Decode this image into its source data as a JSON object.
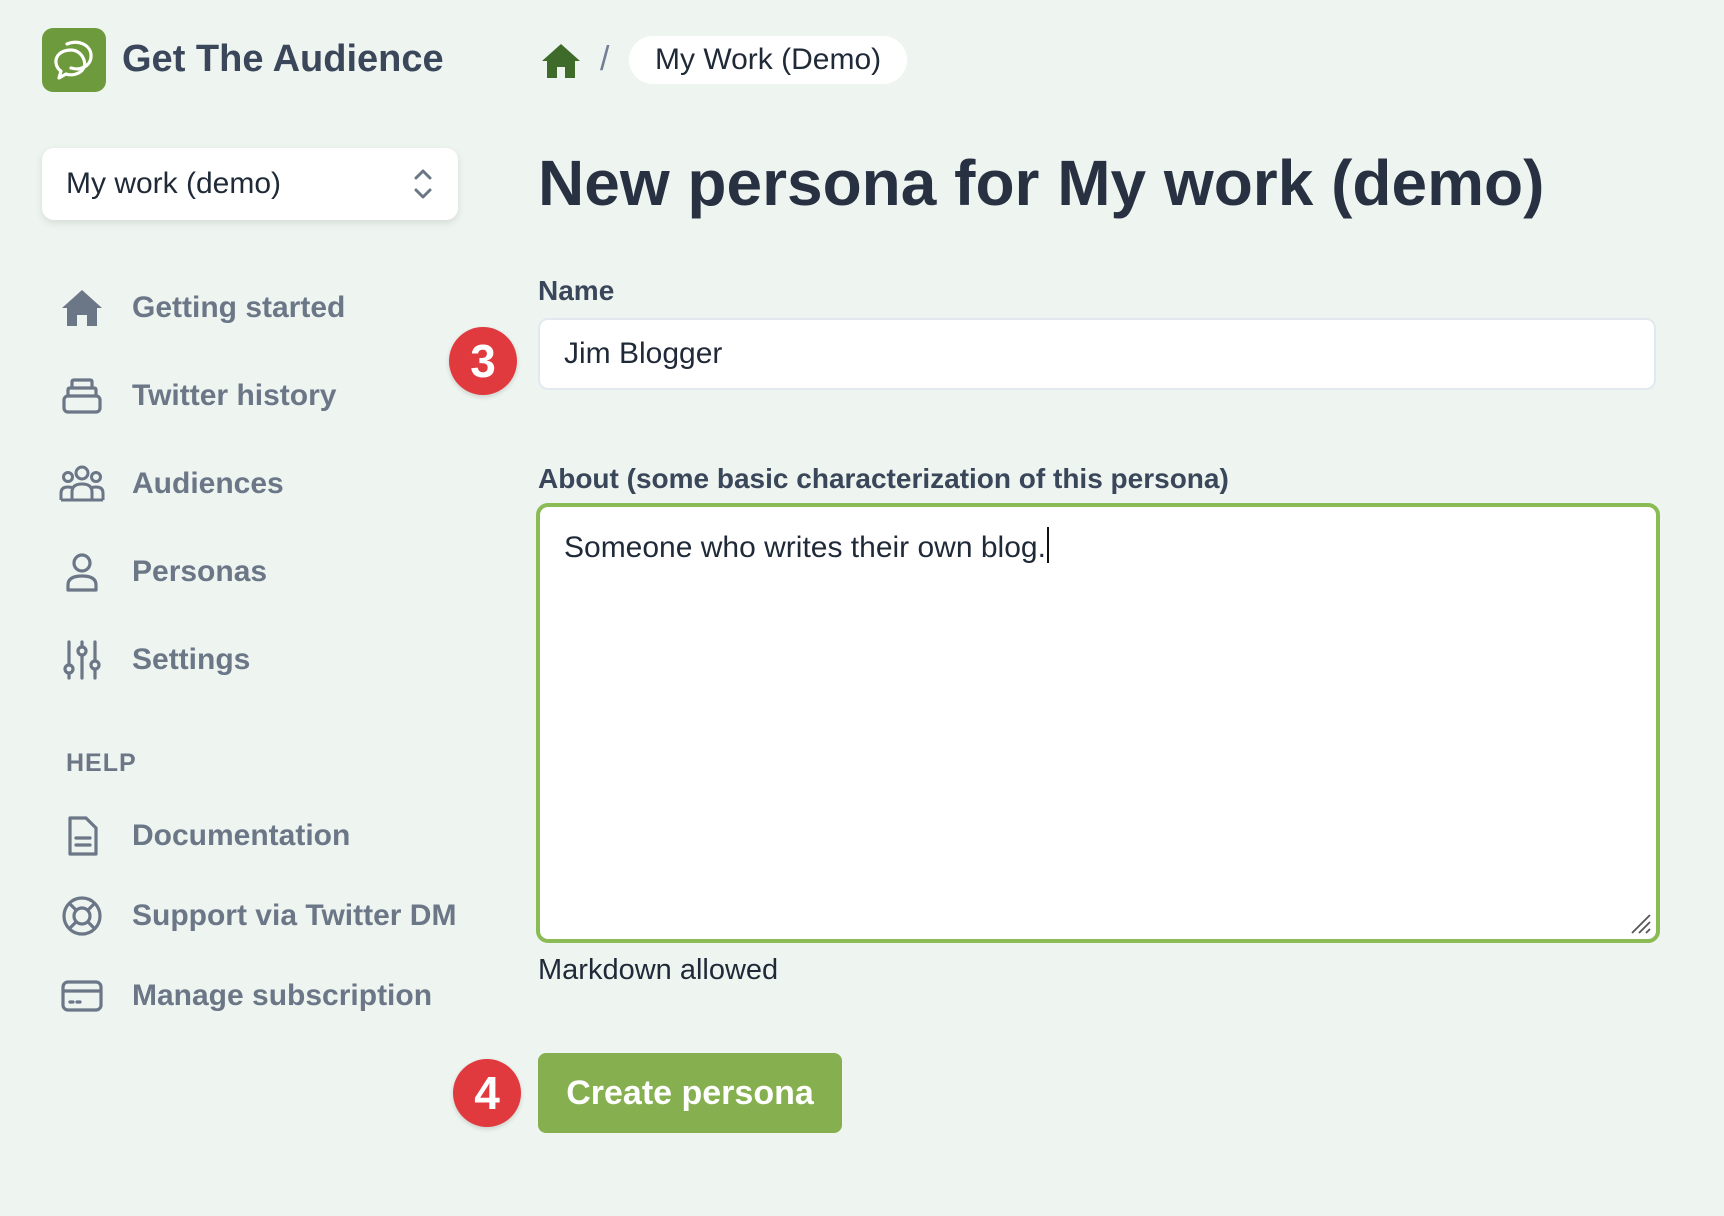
{
  "app": {
    "name": "Get The Audience",
    "accent": "#86b050",
    "brand_color": "#6d9a3c"
  },
  "breadcrumb": {
    "home_icon": "home-icon",
    "separator": "/",
    "current": "My Work (Demo)"
  },
  "workspace_selector": {
    "value": "My work (demo)",
    "icon": "chevron-up-down-icon"
  },
  "sidebar": {
    "items": [
      {
        "label": "Getting started",
        "icon": "home-icon"
      },
      {
        "label": "Twitter history",
        "icon": "archive-icon"
      },
      {
        "label": "Audiences",
        "icon": "user-group-icon"
      },
      {
        "label": "Personas",
        "icon": "user-icon"
      },
      {
        "label": "Settings",
        "icon": "sliders-icon"
      }
    ],
    "help_heading": "HELP",
    "help_items": [
      {
        "label": "Documentation",
        "icon": "document-icon"
      },
      {
        "label": "Support via Twitter DM",
        "icon": "lifebuoy-icon"
      },
      {
        "label": "Manage subscription",
        "icon": "credit-card-icon"
      }
    ]
  },
  "form": {
    "title": "New persona for My work (demo)",
    "name_label": "Name",
    "name_value": "Jim Blogger",
    "about_label": "About (some basic characterization of this persona)",
    "about_value": "Someone who writes their own blog.",
    "about_hint": "Markdown allowed",
    "submit_label": "Create persona"
  },
  "annotations": {
    "step_name": "3",
    "step_submit": "4",
    "color": "#e0393e"
  }
}
